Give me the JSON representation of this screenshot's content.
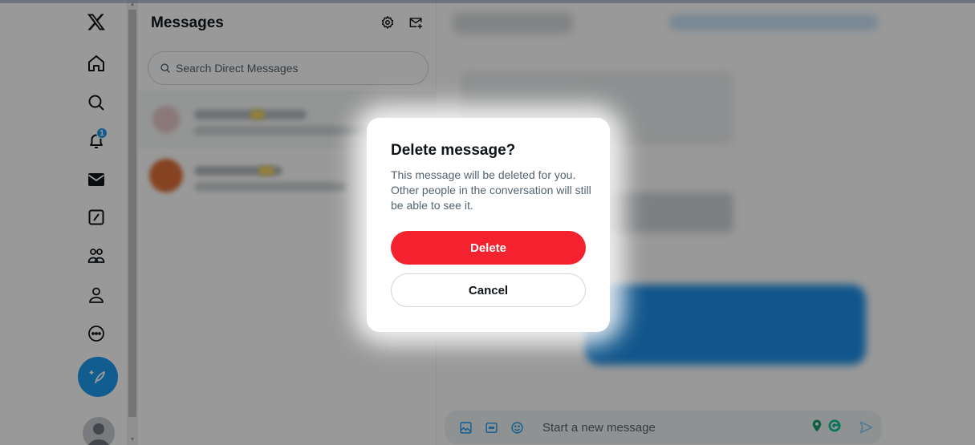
{
  "nav": {
    "items": [
      {
        "name": "x-logo",
        "icon": "x-logo-icon"
      },
      {
        "name": "home",
        "icon": "home-icon"
      },
      {
        "name": "explore",
        "icon": "search-icon"
      },
      {
        "name": "notifications",
        "icon": "bell-icon",
        "badge": "1"
      },
      {
        "name": "messages",
        "icon": "envelope-icon"
      },
      {
        "name": "grok",
        "icon": "slash-square-icon"
      },
      {
        "name": "communities",
        "icon": "people-icon"
      },
      {
        "name": "profile",
        "icon": "person-icon"
      },
      {
        "name": "more",
        "icon": "more-circle-icon"
      }
    ],
    "post_icon": "feather-plus-icon"
  },
  "messages": {
    "title": "Messages",
    "settings_icon": "gear-icon",
    "new_message_icon": "new-message-icon",
    "search_placeholder": "Search Direct Messages"
  },
  "composer": {
    "placeholder": "Start a new message",
    "icons": [
      "image-icon",
      "gif-icon",
      "emoji-icon",
      "send-icon"
    ]
  },
  "dialog": {
    "title": "Delete message?",
    "body": "This message will be deleted for you. Other people in the conversation will still be able to see it.",
    "delete_label": "Delete",
    "cancel_label": "Cancel"
  },
  "colors": {
    "accent": "#1d9bf0",
    "danger": "#f4212e",
    "text_primary": "#0f1419",
    "text_secondary": "#536471",
    "overlay": "rgba(0,0,0,0.4)"
  }
}
